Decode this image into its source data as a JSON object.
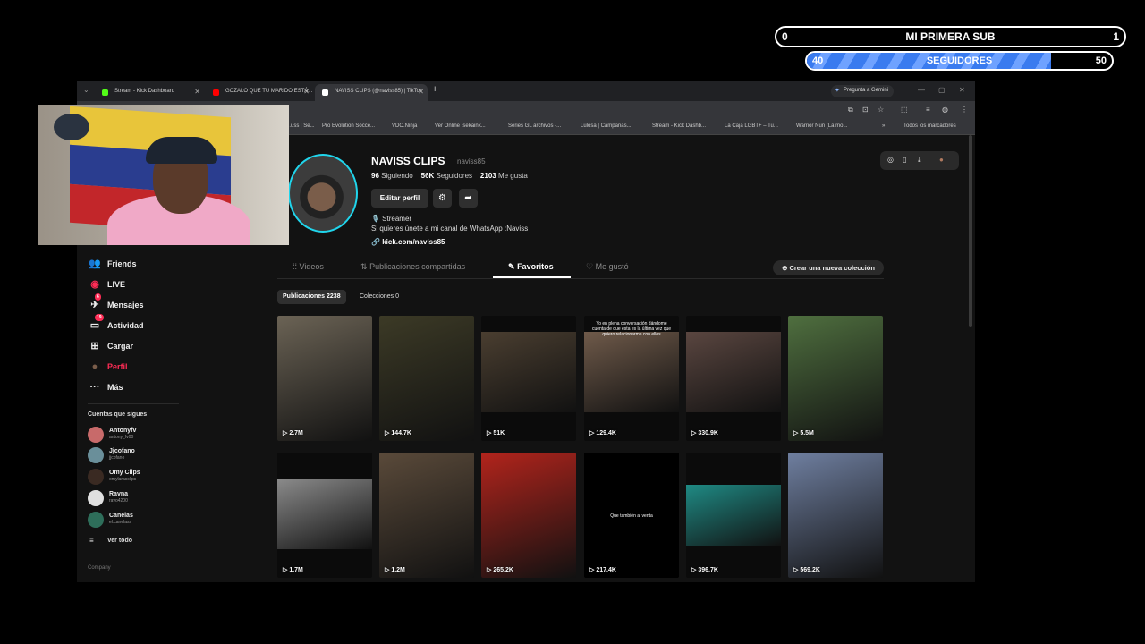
{
  "overlay": {
    "goal_sub": {
      "start": "0",
      "label": "MI PRIMERA SUB",
      "end": "1"
    },
    "goal_followers": {
      "start": "40",
      "label": "SEGUIDORES",
      "end": "50",
      "progress": 0.8
    }
  },
  "browser": {
    "tabs": [
      {
        "title": "Stream - Kick Dashboard",
        "active": false,
        "color": "#53fc18"
      },
      {
        "title": "GOZALO QUE TU MARIDO ESTÁ...",
        "active": false,
        "color": "#ff0000"
      },
      {
        "title": "NAVISS CLIPS (@naviss85) | TikTok",
        "active": true,
        "color": "#ffffff"
      }
    ],
    "new_tab": "+",
    "gemini": "Pregunta a Gemini",
    "bookmarks": [
      "...uss | Se...",
      "Pro Evolution Socce...",
      "VDO.Ninja",
      "Ver Online Isekaink...",
      "Series GL archivos -...",
      "Lulosa | Campañas...",
      "Stream - Kick Dashb...",
      "La Caja LGBT+ – Tu...",
      "Warrior Nun (La mo...",
      "»",
      "Todos los marcadores"
    ]
  },
  "sidebar": {
    "items": [
      {
        "label": "Friends",
        "icon": "friends-icon",
        "glyph": "👥"
      },
      {
        "label": "LIVE",
        "icon": "live-icon",
        "glyph": "◉"
      },
      {
        "label": "Mensajes",
        "icon": "messages-icon",
        "glyph": "✈",
        "badge": "6"
      },
      {
        "label": "Actividad",
        "icon": "activity-icon",
        "glyph": "▭",
        "badge": "19"
      },
      {
        "label": "Cargar",
        "icon": "upload-icon",
        "glyph": "⊞"
      },
      {
        "label": "Perfil",
        "icon": "profile-icon",
        "glyph": "●"
      },
      {
        "label": "Más",
        "icon": "more-icon",
        "glyph": "···"
      }
    ],
    "following_title": "Cuentas que sigues",
    "following": [
      {
        "name": "Antonyfv",
        "handle": "antony_fv00",
        "color": "#c86a6a"
      },
      {
        "name": "Jjcofano",
        "handle": "jjcofano",
        "color": "#6a8f9a"
      },
      {
        "name": "Omy Clips",
        "handle": "omylarasclips",
        "color": "#3a2a22"
      },
      {
        "name": "Ravna",
        "handle": "ravo4200",
        "color": "#e0e0e0"
      },
      {
        "name": "Canelas",
        "handle": "el.canelass",
        "color": "#2e6e5a"
      }
    ],
    "see_all": "Ver todo",
    "company": "Company"
  },
  "profile": {
    "name": "NAVISS CLIPS",
    "handle": "naviss85",
    "following_count": "96",
    "following_label": "Siguiendo",
    "followers_count": "56K",
    "followers_label": "Seguidores",
    "likes_count": "2103",
    "likes_label": "Me gusta",
    "edit_button": "Editar perfil",
    "bio_line1": "🎙️ Streamer",
    "bio_line2": "Si quieres únete a mi canal de WhatsApp :Naviss",
    "link": "kick.com/naviss85"
  },
  "tabs": [
    {
      "label": "Videos",
      "glyph": "⁞⁞"
    },
    {
      "label": "Publicaciones compartidas",
      "glyph": "⇅"
    },
    {
      "label": "Favoritos",
      "glyph": "✎"
    },
    {
      "label": "Me gustó",
      "glyph": "♡"
    }
  ],
  "new_collection": "⊕ Crear una nueva colección",
  "chips": [
    {
      "label": "Publicaciones 2238"
    },
    {
      "label": "Colecciones 0"
    }
  ],
  "videos": [
    {
      "views": "2.7M",
      "color": "#6b6355",
      "caption": ""
    },
    {
      "views": "144.7K",
      "color": "#3c3a26",
      "caption": ""
    },
    {
      "views": "51K",
      "color": "#4a3e30",
      "caption": ""
    },
    {
      "views": "129.4K",
      "color": "#6f5a4a",
      "caption": "Yo en plena conversación dándome cuenta de que esta es la última vez que quiero relacionarme con ellos"
    },
    {
      "views": "330.9K",
      "color": "#5a4640",
      "caption": ""
    },
    {
      "views": "5.5M",
      "color": "#4f6f3f",
      "caption": ""
    },
    {
      "views": "1.7M",
      "color": "#8a8a8a",
      "caption": ""
    },
    {
      "views": "1.2M",
      "color": "#5a4a3a",
      "caption": ""
    },
    {
      "views": "265.2K",
      "color": "#b2241c",
      "caption": ""
    },
    {
      "views": "217.4K",
      "color": "#000000",
      "caption": "Que también al venta"
    },
    {
      "views": "396.7K",
      "color": "#1f8a84",
      "caption": ""
    },
    {
      "views": "569.2K",
      "color": "#6f7fa0",
      "caption": ""
    }
  ]
}
